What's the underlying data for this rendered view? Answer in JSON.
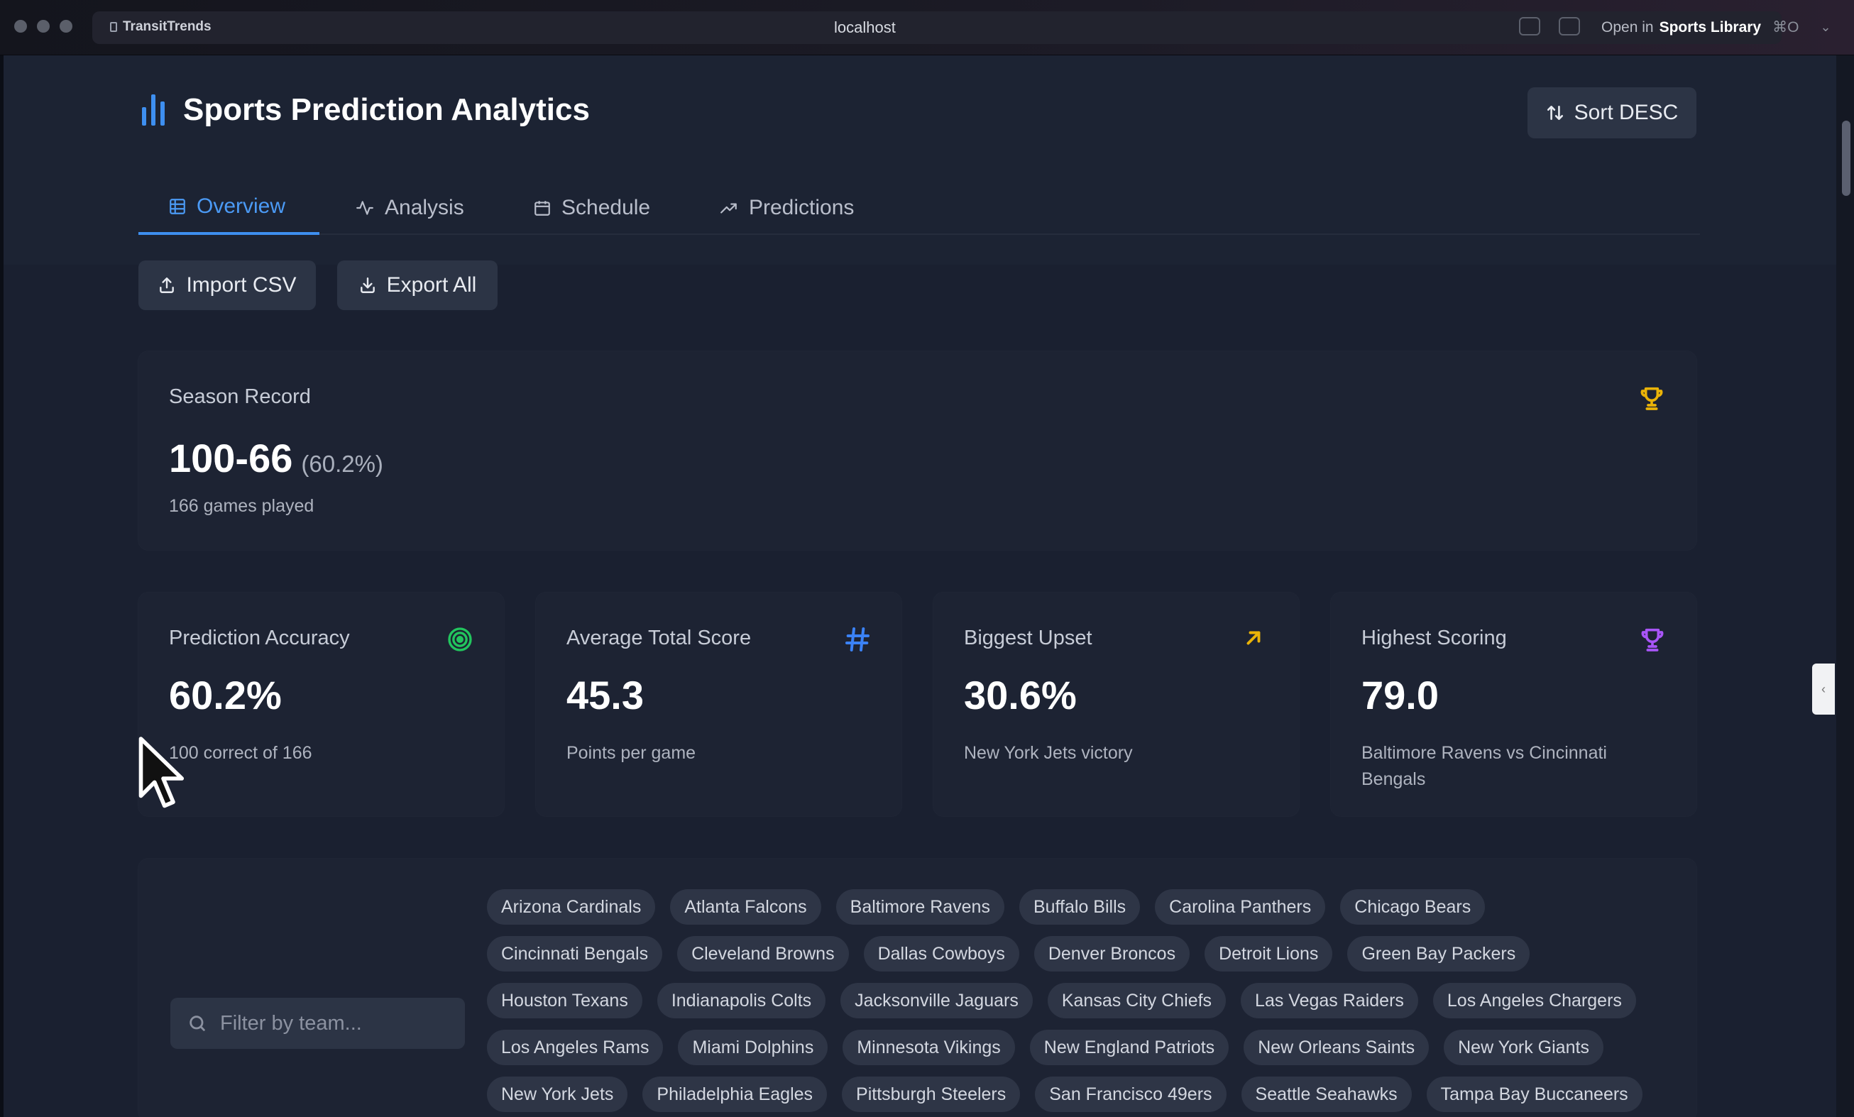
{
  "browser": {
    "site_name": "TransitTrends",
    "url": "localhost",
    "open_in_prefix": "Open in",
    "open_in_app": "Sports Library",
    "shortcut": "⌘O"
  },
  "header": {
    "title": "Sports Prediction Analytics",
    "sort_button": "Sort DESC"
  },
  "tabs": [
    {
      "label": "Overview",
      "icon": "table-icon",
      "active": true
    },
    {
      "label": "Analysis",
      "icon": "activity-icon",
      "active": false
    },
    {
      "label": "Schedule",
      "icon": "calendar-icon",
      "active": false
    },
    {
      "label": "Predictions",
      "icon": "trend-up-icon",
      "active": false
    }
  ],
  "actions": {
    "import": "Import CSV",
    "export": "Export All"
  },
  "season_record": {
    "label": "Season Record",
    "record": "100-66",
    "percent": "(60.2%)",
    "games": "166 games played"
  },
  "stats": [
    {
      "label": "Prediction Accuracy",
      "value": "60.2%",
      "sub": "100 correct of 166",
      "icon": "target-icon",
      "color": "#22c55e"
    },
    {
      "label": "Average Total Score",
      "value": "45.3",
      "sub": "Points per game",
      "icon": "hash-icon",
      "color": "#3b82f6"
    },
    {
      "label": "Biggest Upset",
      "value": "30.6%",
      "sub": "New York Jets victory",
      "icon": "arrow-up-right-icon",
      "color": "#eab308"
    },
    {
      "label": "Highest Scoring",
      "value": "79.0",
      "sub": "Baltimore Ravens vs Cincinnati Bengals",
      "icon": "trophy-icon",
      "color": "#a855f7"
    }
  ],
  "filter": {
    "placeholder": "Filter by team..."
  },
  "teams": [
    [
      "Arizona Cardinals",
      "Atlanta Falcons",
      "Baltimore Ravens",
      "Buffalo Bills",
      "Carolina Panthers",
      "Chicago Bears"
    ],
    [
      "Cincinnati Bengals",
      "Cleveland Browns",
      "Dallas Cowboys",
      "Denver Broncos",
      "Detroit Lions",
      "Green Bay Packers"
    ],
    [
      "Houston Texans",
      "Indianapolis Colts",
      "Jacksonville Jaguars",
      "Kansas City Chiefs",
      "Las Vegas Raiders",
      "Los Angeles Chargers"
    ],
    [
      "Los Angeles Rams",
      "Miami Dolphins",
      "Minnesota Vikings",
      "New England Patriots",
      "New Orleans Saints",
      "New York Giants"
    ],
    [
      "New York Jets",
      "Philadelphia Eagles",
      "Pittsburgh Steelers",
      "San Francisco 49ers",
      "Seattle Seahawks",
      "Tampa Bay Buccaneers"
    ]
  ],
  "colors": {
    "accent": "#3e8ff0",
    "gold": "#eab308"
  }
}
